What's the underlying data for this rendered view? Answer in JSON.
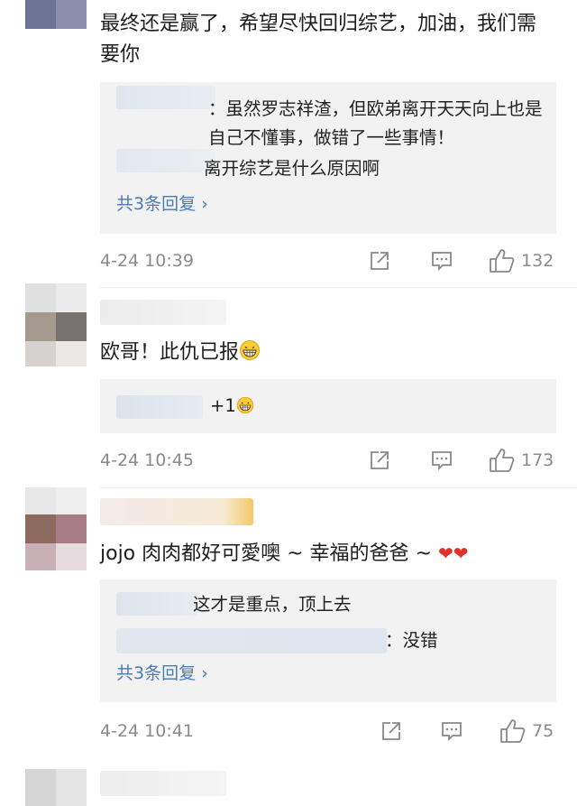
{
  "comments": [
    {
      "text": "最终还是赢了，希望尽快回归综艺，加油，我们需要你",
      "replies": [
        "：虽然罗志祥渣，但欧弟离开天天向上也是自己不懂事，做错了一些事情！",
        "离开综艺是什么原因啊"
      ],
      "more_replies": "共3条回复 ›",
      "time": "4-24 10:39",
      "likes": "132"
    },
    {
      "text": "欧哥！此仇已报",
      "replies": [
        "+1"
      ],
      "time": "4-24 10:45",
      "likes": "173"
    },
    {
      "text": "jojo 肉肉都好可愛噢 ~ 幸福的爸爸 ~",
      "replies": [
        "这才是重点，顶上去",
        "：没错"
      ],
      "more_replies": "共3条回复 ›",
      "time": "4-24 10:41",
      "likes": "75"
    }
  ],
  "icons": {
    "share": "share-icon",
    "comment": "comment-icon",
    "like": "thumbs-up-icon",
    "grin": "grin-emoji-icon",
    "heart": "heart-emoji-icon"
  },
  "colors": {
    "link": "#4a7bb5",
    "meta": "#8a8a8a",
    "reply_bg": "#f2f2f2",
    "heart": "#e0322a"
  }
}
